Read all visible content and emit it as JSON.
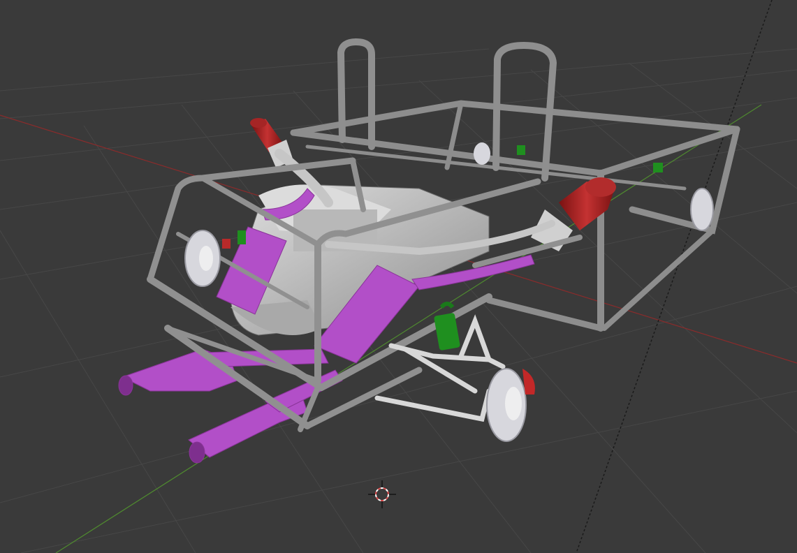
{
  "viewport": {
    "name": "3D viewport",
    "background_color": "#3a3a3a",
    "grid_color": "#454545",
    "x_axis_color": "#8b2b2b",
    "y_axis_color": "#4f8a2f"
  },
  "model": {
    "frame_color": "#8a8a8a",
    "frame_highlight": "#b0b0b0",
    "exhaust_color": "#b24fc8",
    "air_filter_color": "#b82a2a",
    "shock_color": "#1f8f1f",
    "engine_color": "#c9c9c9",
    "wheel_color": "#d7d7dd"
  },
  "cursor_3d": {
    "icon": "3d-cursor-icon",
    "ring_color_1": "#e05050",
    "ring_color_2": "#ffffff"
  }
}
